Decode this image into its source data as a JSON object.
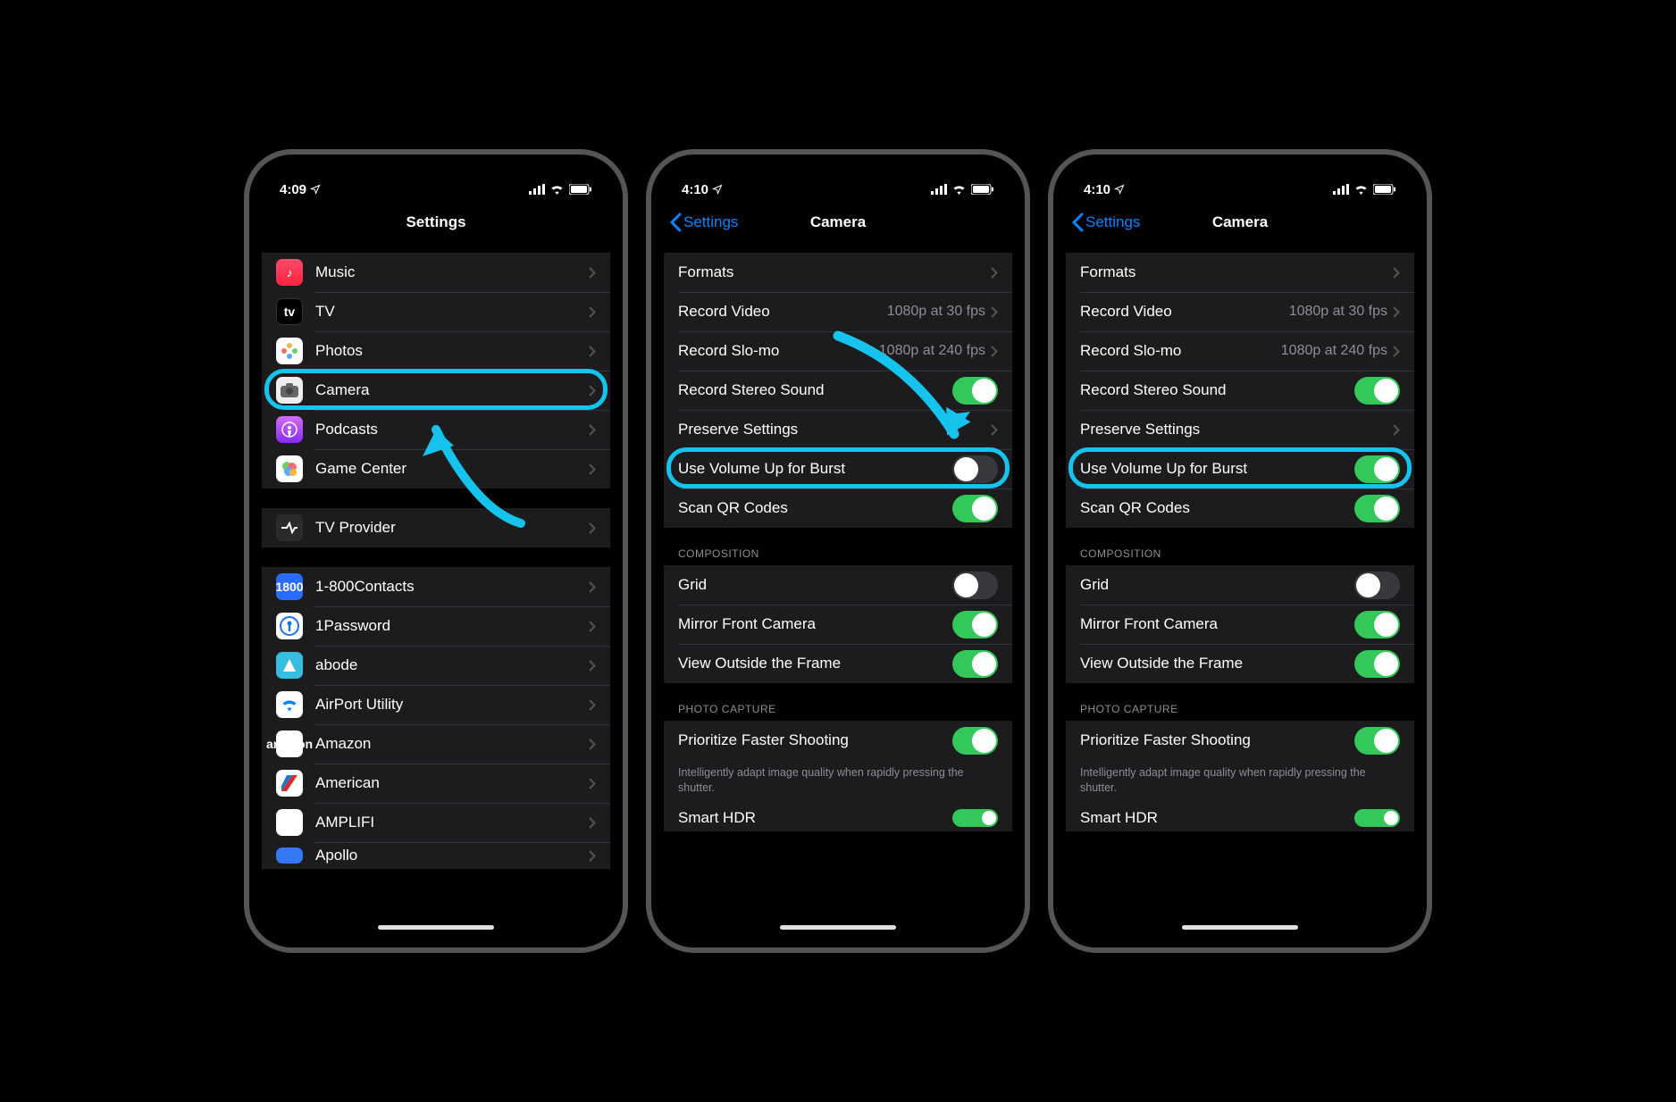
{
  "status": {
    "time_a": "4:09",
    "time_b": "4:10",
    "time_c": "4:10"
  },
  "screen_a": {
    "title": "Settings",
    "group1": [
      {
        "label": "Music",
        "icon": "music"
      },
      {
        "label": "TV",
        "icon": "tv"
      },
      {
        "label": "Photos",
        "icon": "photos"
      },
      {
        "label": "Camera",
        "icon": "camera",
        "highlighted": true
      },
      {
        "label": "Podcasts",
        "icon": "podcasts"
      },
      {
        "label": "Game Center",
        "icon": "gamecenter"
      }
    ],
    "group2": [
      {
        "label": "TV Provider",
        "icon": "tvprovider"
      }
    ],
    "group3": [
      {
        "label": "1-800Contacts",
        "icon": "1800"
      },
      {
        "label": "1Password",
        "icon": "1pw"
      },
      {
        "label": "abode",
        "icon": "abode"
      },
      {
        "label": "AirPort Utility",
        "icon": "airport"
      },
      {
        "label": "Amazon",
        "icon": "amazon"
      },
      {
        "label": "American",
        "icon": "american"
      },
      {
        "label": "AMPLIFI",
        "icon": "amplifi"
      },
      {
        "label": "Apollo",
        "icon": "apollo"
      }
    ]
  },
  "screen_b": {
    "back": "Settings",
    "title": "Camera",
    "rows": {
      "formats": {
        "label": "Formats"
      },
      "record_video": {
        "label": "Record Video",
        "value": "1080p at 30 fps"
      },
      "record_slomo": {
        "label": "Record Slo-mo",
        "value": "1080p at 240 fps"
      },
      "stereo": {
        "label": "Record Stereo Sound",
        "on": true
      },
      "preserve": {
        "label": "Preserve Settings"
      },
      "burst": {
        "label": "Use Volume Up for Burst",
        "on": false,
        "highlighted": true
      },
      "qr": {
        "label": "Scan QR Codes",
        "on": true
      }
    },
    "composition_header": "COMPOSITION",
    "composition": {
      "grid": {
        "label": "Grid",
        "on": false
      },
      "mirror": {
        "label": "Mirror Front Camera",
        "on": true
      },
      "frame": {
        "label": "View Outside the Frame",
        "on": true
      }
    },
    "photo_header": "PHOTO CAPTURE",
    "photo": {
      "faster": {
        "label": "Prioritize Faster Shooting",
        "on": true
      }
    },
    "footer": "Intelligently adapt image quality when rapidly pressing the shutter.",
    "smart_hdr": {
      "label": "Smart HDR",
      "on": true
    }
  },
  "screen_c": {
    "back": "Settings",
    "title": "Camera",
    "rows": {
      "formats": {
        "label": "Formats"
      },
      "record_video": {
        "label": "Record Video",
        "value": "1080p at 30 fps"
      },
      "record_slomo": {
        "label": "Record Slo-mo",
        "value": "1080p at 240 fps"
      },
      "stereo": {
        "label": "Record Stereo Sound",
        "on": true
      },
      "preserve": {
        "label": "Preserve Settings"
      },
      "burst": {
        "label": "Use Volume Up for Burst",
        "on": true,
        "highlighted": true
      },
      "qr": {
        "label": "Scan QR Codes",
        "on": true
      }
    },
    "composition_header": "COMPOSITION",
    "composition": {
      "grid": {
        "label": "Grid",
        "on": false
      },
      "mirror": {
        "label": "Mirror Front Camera",
        "on": true
      },
      "frame": {
        "label": "View Outside the Frame",
        "on": true
      }
    },
    "photo_header": "PHOTO CAPTURE",
    "photo": {
      "faster": {
        "label": "Prioritize Faster Shooting",
        "on": true
      }
    },
    "footer": "Intelligently adapt image quality when rapidly pressing the shutter.",
    "smart_hdr": {
      "label": "Smart HDR",
      "on": true
    }
  }
}
